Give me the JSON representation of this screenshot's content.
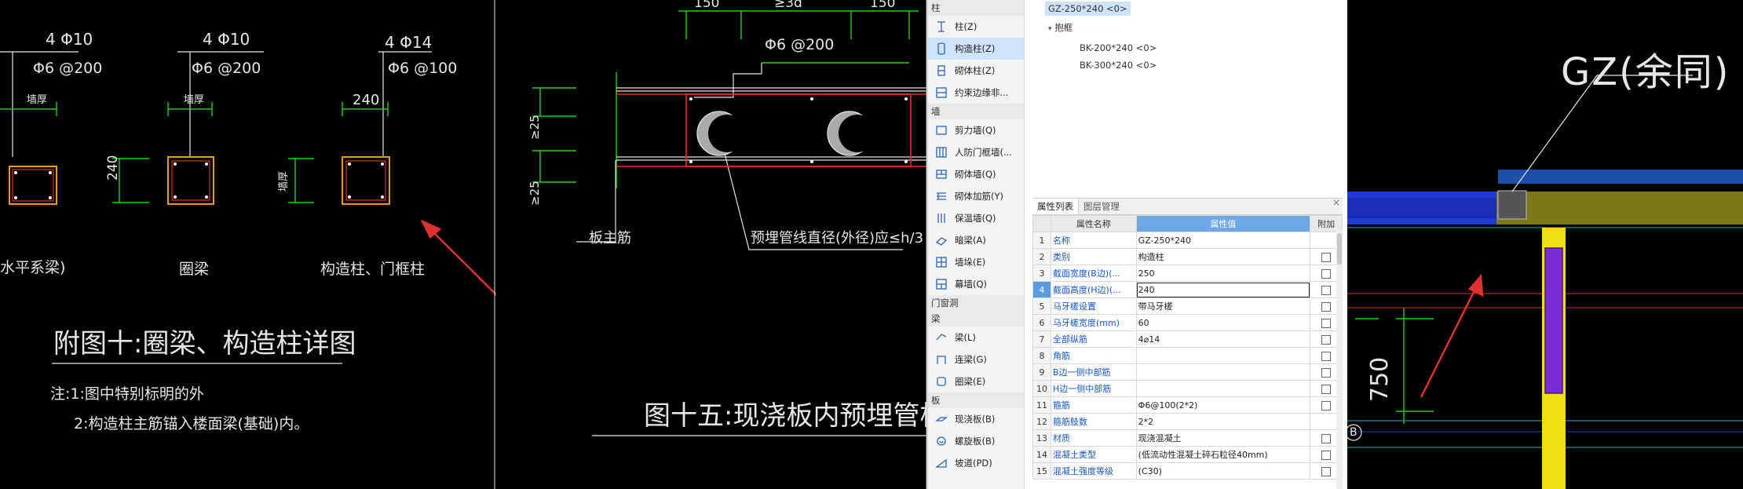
{
  "cad1": {
    "rebar_labels": [
      "4 Φ10",
      "4 Φ10",
      "4 Φ14"
    ],
    "stirrup_labels": [
      "Φ6 @200",
      "Φ6 @200",
      "Φ6 @100"
    ],
    "wall_thickness_labels": [
      "墙厚",
      "墙厚",
      "墙厚"
    ],
    "dim_240_top": "240",
    "dim_240_left": "240",
    "captions": [
      "水平系梁)",
      "圈梁",
      "构造柱、门框柱"
    ],
    "title": "附图十:圈梁、构造柱详图",
    "note1": "注:1:图中特别标明的外",
    "note2": "2:构造柱主筋锚入楼面梁(基础)内。"
  },
  "cad2": {
    "dim_left": "150",
    "dim_mid": "≥3d",
    "dim_right": "150",
    "stirrup": "Φ6 @200",
    "dim_v1": "≥25",
    "dim_v2": "≥25",
    "slab_label": "板主筋",
    "pipe_note": "预埋管线直径(外径)应≤h/3",
    "title": "图十五:现浇板内预埋管构造详图"
  },
  "ui": {
    "sidebar": [
      {
        "type": "cat",
        "label": "柱"
      },
      {
        "type": "item",
        "label": "柱(Z)",
        "icon": "column-icon"
      },
      {
        "type": "item",
        "label": "构造柱(Z)",
        "icon": "structural-column-icon",
        "selected": true
      },
      {
        "type": "item",
        "label": "砌体柱(Z)",
        "icon": "masonry-column-icon"
      },
      {
        "type": "item",
        "label": "约束边缘非...",
        "icon": "boundary-edge-icon"
      },
      {
        "type": "cat",
        "label": "墙"
      },
      {
        "type": "item",
        "label": "剪力墙(Q)",
        "icon": "shear-wall-icon"
      },
      {
        "type": "item",
        "label": "人防门框墙(...",
        "icon": "blast-door-wall-icon"
      },
      {
        "type": "item",
        "label": "砌体墙(Q)",
        "icon": "masonry-wall-icon"
      },
      {
        "type": "item",
        "label": "砌体加筋(Y)",
        "icon": "masonry-rebar-icon"
      },
      {
        "type": "item",
        "label": "保温墙(Q)",
        "icon": "insulation-wall-icon"
      },
      {
        "type": "item",
        "label": "暗梁(A)",
        "icon": "hidden-beam-icon"
      },
      {
        "type": "item",
        "label": "墙垛(E)",
        "icon": "wall-pier-icon"
      },
      {
        "type": "item",
        "label": "幕墙(Q)",
        "icon": "curtain-wall-icon"
      },
      {
        "type": "cat",
        "label": "门窗洞"
      },
      {
        "type": "cat",
        "label": "梁"
      },
      {
        "type": "item",
        "label": "梁(L)",
        "icon": "beam-icon"
      },
      {
        "type": "item",
        "label": "连梁(G)",
        "icon": "coupling-beam-icon"
      },
      {
        "type": "item",
        "label": "圈梁(E)",
        "icon": "ring-beam-icon"
      },
      {
        "type": "cat",
        "label": "板"
      },
      {
        "type": "item",
        "label": "现浇板(B)",
        "icon": "cast-slab-icon"
      },
      {
        "type": "item",
        "label": "螺旋板(B)",
        "icon": "spiral-slab-icon"
      },
      {
        "type": "item",
        "label": "坡道(PD)",
        "icon": "ramp-icon"
      }
    ],
    "tree": {
      "selected_item": "GZ-250*240  <0>",
      "group": "抱框",
      "children": [
        "BK-200*240  <0>",
        "BK-300*240  <0>"
      ]
    },
    "tabs": [
      "属性列表",
      "图层管理"
    ],
    "table": {
      "headers": [
        "",
        "属性名称",
        "属性值",
        "附加"
      ],
      "rows": [
        {
          "n": "1",
          "name": "名称",
          "value": "GZ-250*240",
          "check": false
        },
        {
          "n": "2",
          "name": "类别",
          "value": "构造柱",
          "check": true
        },
        {
          "n": "3",
          "name": "截面宽度(B边)(...",
          "value": "250",
          "check": true
        },
        {
          "n": "4",
          "name": "截面高度(H边)(...",
          "value": "240",
          "check": true
        },
        {
          "n": "5",
          "name": "马牙槎设置",
          "value": "带马牙槎",
          "check": true
        },
        {
          "n": "6",
          "name": "马牙槎宽度(mm)",
          "value": "60",
          "check": true
        },
        {
          "n": "7",
          "name": "全部纵筋",
          "value": "4⌀14",
          "check": true
        },
        {
          "n": "8",
          "name": "角筋",
          "value": "",
          "check": true
        },
        {
          "n": "9",
          "name": "B边一侧中部筋",
          "value": "",
          "check": true
        },
        {
          "n": "10",
          "name": "H边一侧中部筋",
          "value": "",
          "check": true
        },
        {
          "n": "11",
          "name": "箍筋",
          "value": "Φ6@100(2*2)",
          "check": true
        },
        {
          "n": "12",
          "name": "箍筋肢数",
          "value": "2*2",
          "check": false
        },
        {
          "n": "13",
          "name": "材质",
          "value": "现浇混凝土",
          "check": true
        },
        {
          "n": "14",
          "name": "混凝土类型",
          "value": "(低流动性混凝土碎石粒径40mm)",
          "check": true
        },
        {
          "n": "15",
          "name": "混凝土强度等级",
          "value": "(C30)",
          "check": true
        }
      ]
    }
  },
  "cad3": {
    "label": "GZ(余同)",
    "dim_750": "750",
    "axis_b": "B"
  },
  "colors": {
    "cad_bg": "#000000",
    "green": "#19d219",
    "red": "#e03030",
    "blue_wall": "#1f3ad6",
    "purple_col": "#7b2cd8",
    "yellow": "#f0e010"
  }
}
